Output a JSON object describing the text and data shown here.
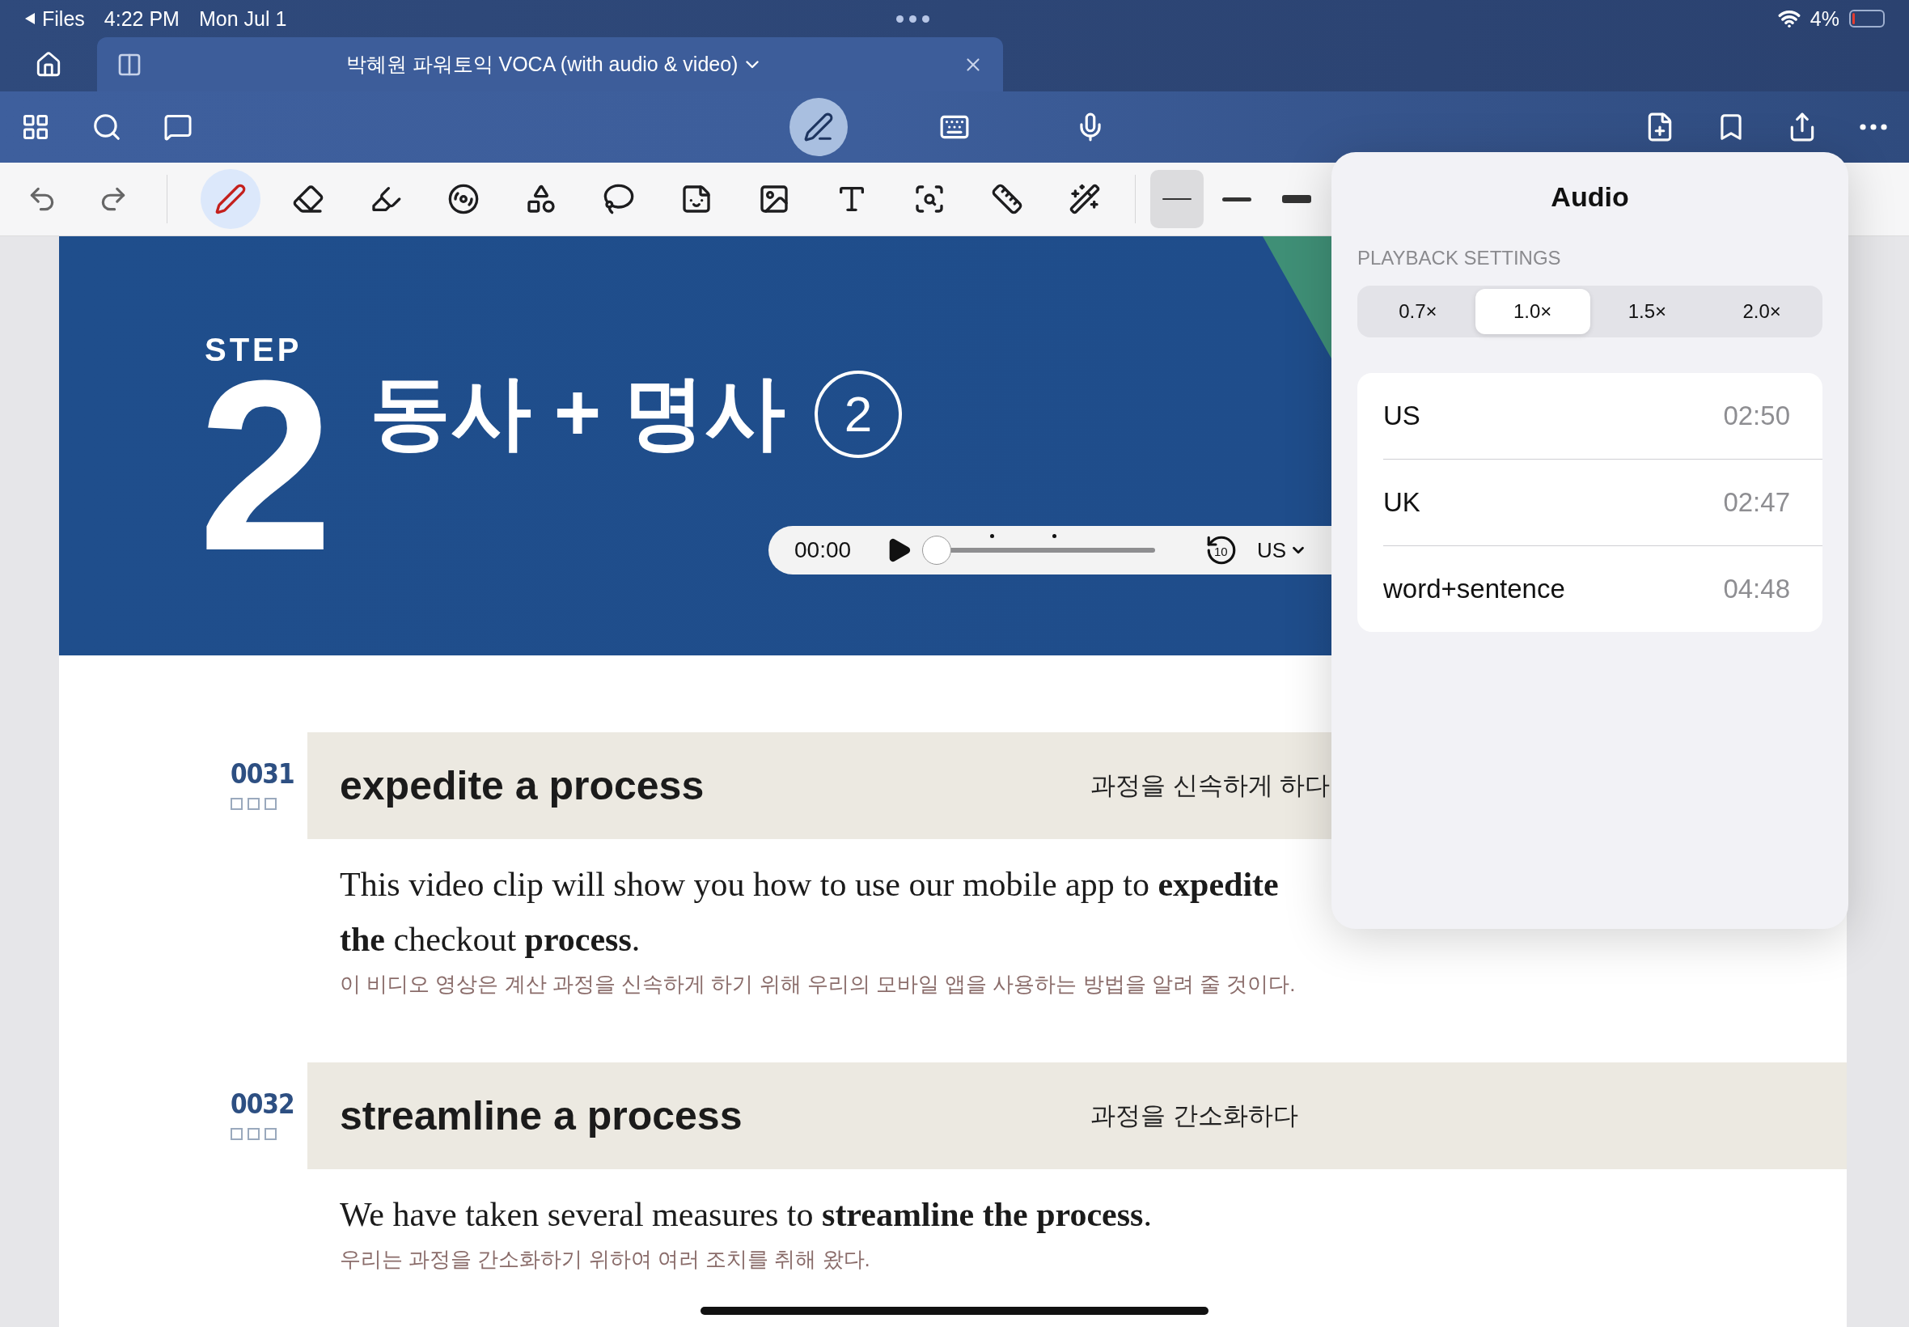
{
  "status_bar": {
    "back": "Files",
    "time": "4:22 PM",
    "date": "Mon Jul 1",
    "battery": "4%"
  },
  "tab": {
    "title": "박혜원 파워토익 VOCA (with audio & video)"
  },
  "modes": [
    {
      "kind": "pen",
      "selected": true
    },
    {
      "kind": "keyboard",
      "selected": false
    },
    {
      "kind": "mic",
      "selected": false
    }
  ],
  "tools": [
    {
      "kind": "pen",
      "selected": true
    },
    {
      "kind": "eraser",
      "selected": false
    },
    {
      "kind": "highlighter",
      "selected": false
    },
    {
      "kind": "tape",
      "selected": false
    },
    {
      "kind": "shapes",
      "selected": false
    },
    {
      "kind": "lasso",
      "selected": false
    },
    {
      "kind": "sticker",
      "selected": false
    },
    {
      "kind": "image",
      "selected": false
    },
    {
      "kind": "text",
      "selected": false
    },
    {
      "kind": "zoom",
      "selected": false
    },
    {
      "kind": "ruler",
      "selected": false
    },
    {
      "kind": "laser",
      "selected": false
    }
  ],
  "thickness": [
    {
      "kind": "thin",
      "selected": true
    },
    {
      "kind": "medium",
      "selected": false
    },
    {
      "kind": "thick",
      "selected": false
    }
  ],
  "hero": {
    "step_label": "STEP",
    "step_number": "2",
    "title": "동사 + 명사",
    "badge": "2"
  },
  "player": {
    "time": "00:00",
    "level": 0,
    "skip": "10",
    "language": "US"
  },
  "entries": [
    {
      "number": "0031",
      "checkboxes": [
        {
          "checked": false
        },
        {
          "checked": false
        },
        {
          "checked": false
        }
      ],
      "phrase": "expedite a process",
      "meaning": "과정을 신속하게 하다",
      "sentence": "This video clip will show you how to use our mobile app to **expedite the** checkout **process**.",
      "translation": "이 비디오 영상은 계산 과정을 신속하게 하기 위해 우리의 모바일 앱을 사용하는 방법을 알려 줄 것이다."
    },
    {
      "number": "0032",
      "checkboxes": [
        {
          "checked": false
        },
        {
          "checked": false
        },
        {
          "checked": false
        }
      ],
      "phrase": "streamline a process",
      "meaning": "과정을 간소화하다",
      "sentence": "We have taken several measures to **streamline the process**.",
      "translation": "우리는 과정을 간소화하기 위하여 여러 조치를 취해 왔다."
    }
  ],
  "audio_popup": {
    "title": "Audio",
    "section": "PLAYBACK SETTINGS",
    "speeds": [
      {
        "label": "0.7×",
        "selected": false
      },
      {
        "label": "1.0×",
        "selected": true
      },
      {
        "label": "1.5×",
        "selected": false
      },
      {
        "label": "2.0×",
        "selected": false
      }
    ],
    "tracks": [
      {
        "name": "US",
        "duration": "02:50"
      },
      {
        "name": "UK",
        "duration": "02:47"
      },
      {
        "name": "word+sentence",
        "duration": "04:48"
      }
    ]
  }
}
